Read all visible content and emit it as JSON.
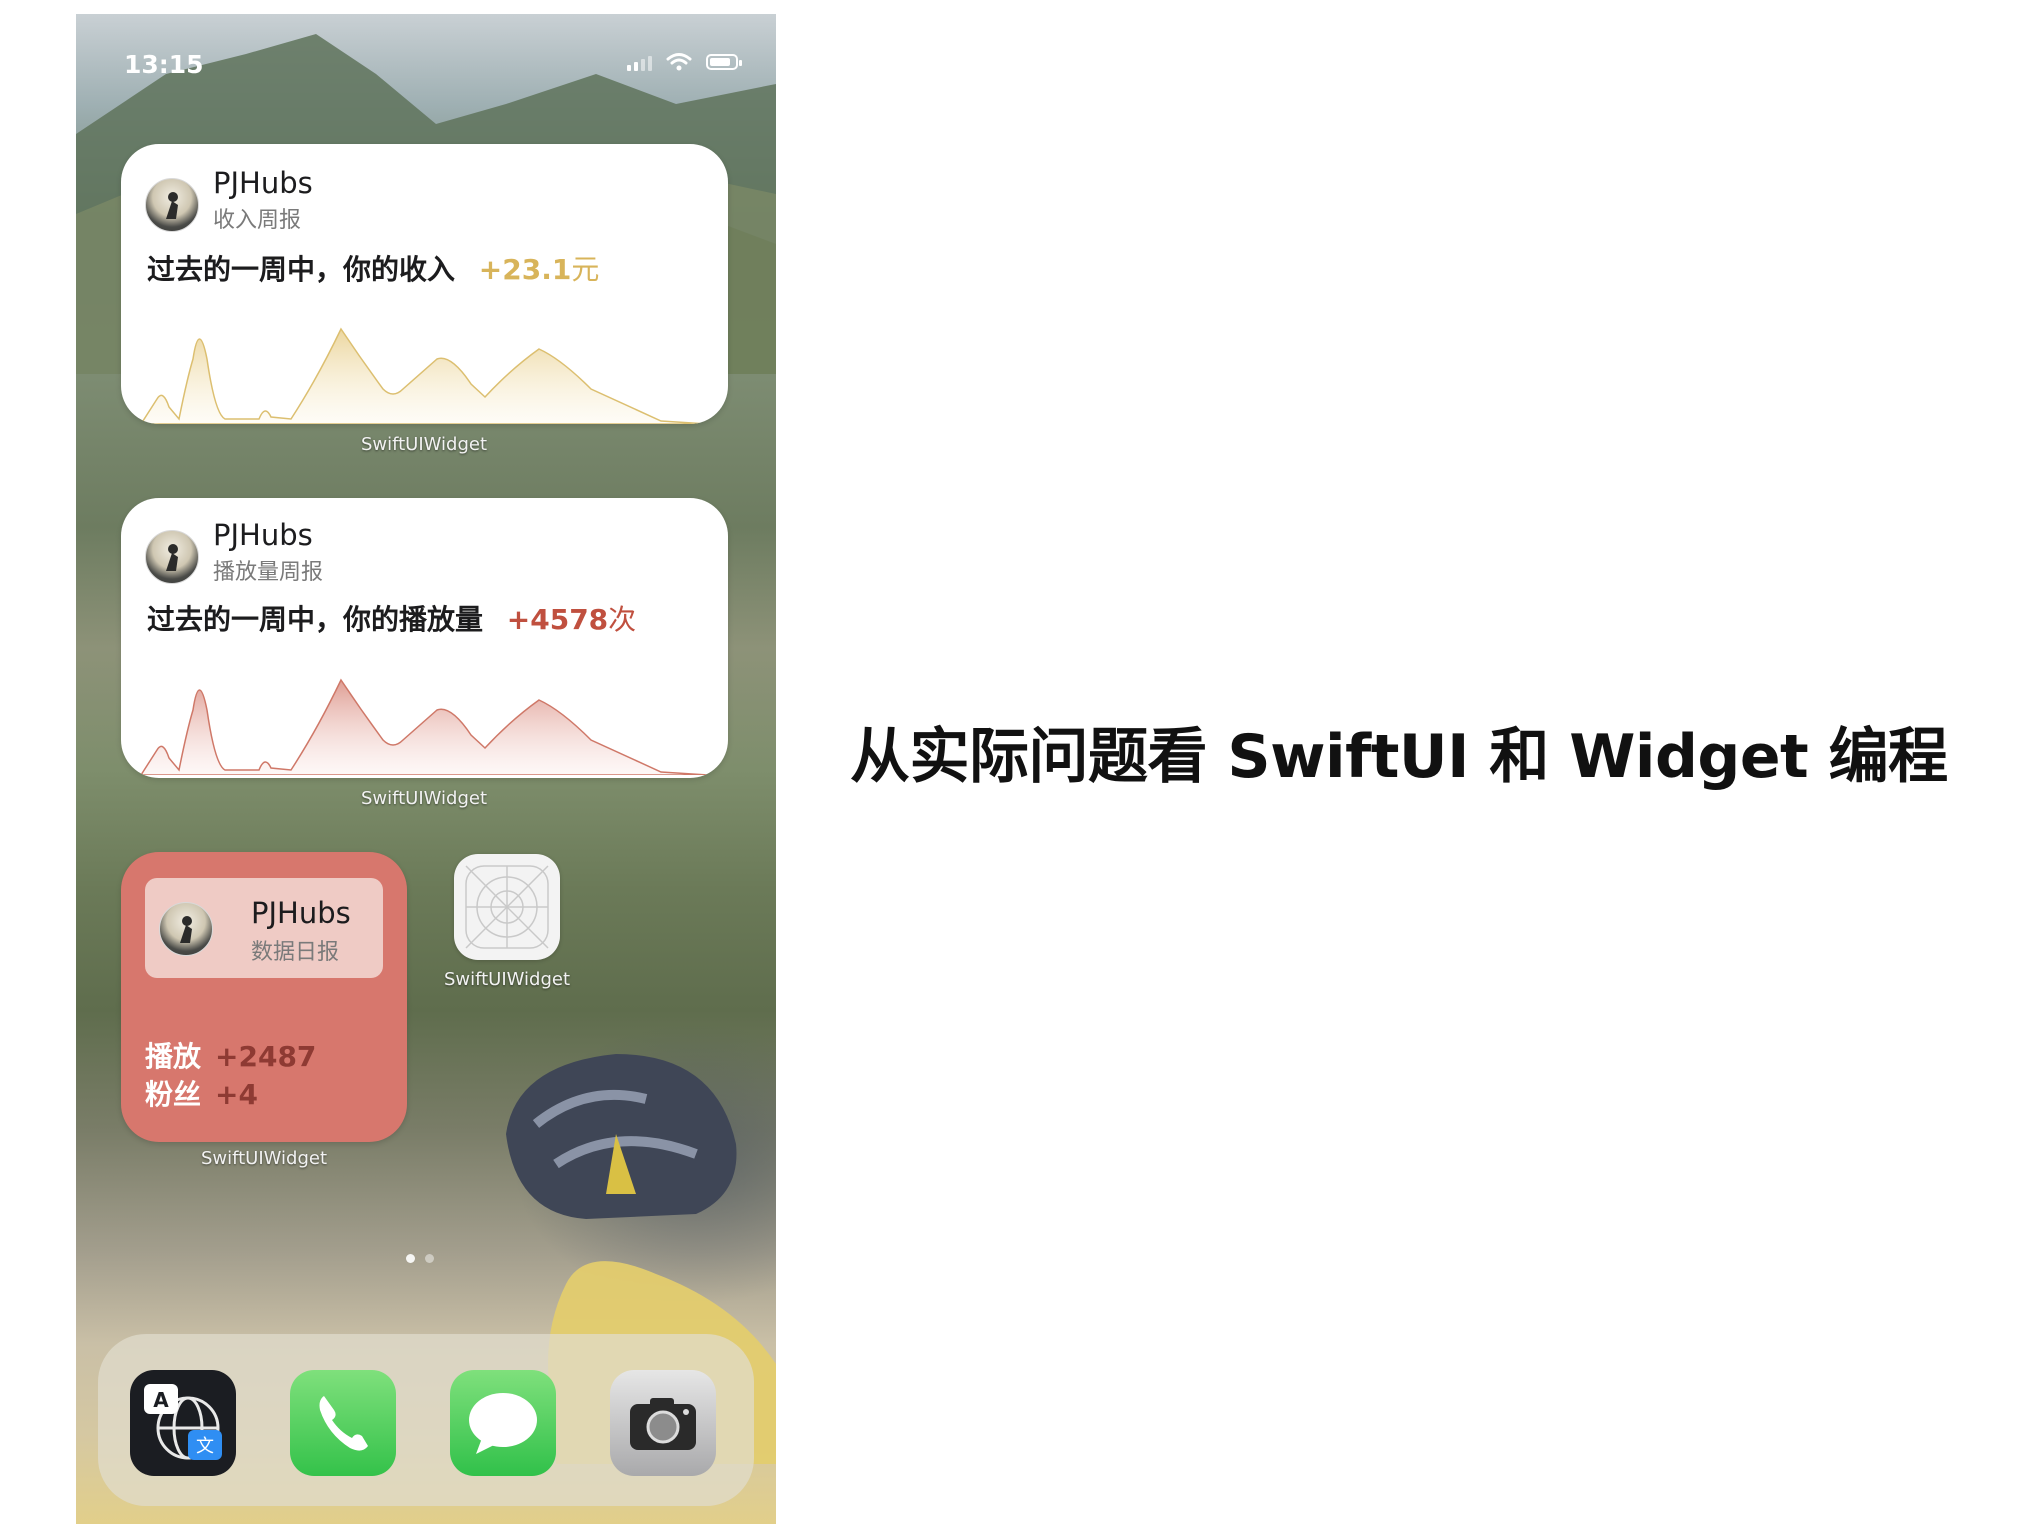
{
  "status_bar": {
    "time": "13:15"
  },
  "widgets": [
    {
      "title": "PJHubs",
      "subtitle": "收入周报",
      "sentence_prefix": "过去的一周中，你的收入",
      "value": "+23.1",
      "unit": "元",
      "accent_color": "#d8b45a",
      "label": "SwiftUIWidget"
    },
    {
      "title": "PJHubs",
      "subtitle": "播放量周报",
      "sentence_prefix": "过去的一周中，你的播放量",
      "value": "+4578",
      "unit": "次",
      "accent_color": "#c0503f",
      "label": "SwiftUIWidget"
    }
  ],
  "small_widget": {
    "title": "PJHubs",
    "subtitle": "数据日报",
    "stats": [
      {
        "label": "播放",
        "value": "+2487"
      },
      {
        "label": "粉丝",
        "value": "+4"
      }
    ],
    "background_color": "#d7776d",
    "label": "SwiftUIWidget"
  },
  "placeholder_app": {
    "label": "SwiftUIWidget"
  },
  "dock": {
    "apps": [
      {
        "name": "translate-app-icon"
      },
      {
        "name": "phone-app-icon"
      },
      {
        "name": "messages-app-icon"
      },
      {
        "name": "camera-app-icon"
      }
    ]
  },
  "headline": "从实际问题看 SwiftUI 和 Widget 编程"
}
